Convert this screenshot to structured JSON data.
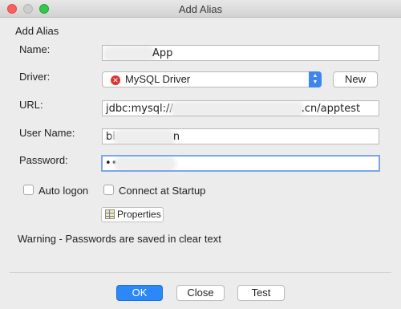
{
  "window": {
    "title": "Add Alias"
  },
  "section_title": "Add Alias",
  "form": {
    "name": {
      "label": "Name:",
      "value_suffix": "App"
    },
    "driver": {
      "label": "Driver:",
      "selected": "MySQL Driver",
      "new_label": "New"
    },
    "url": {
      "label": "URL:",
      "value_prefix": "jdbc:mysql://",
      "value_suffix": ".cn/apptest"
    },
    "user_name": {
      "label": "User Name:",
      "value_prefix": "bi",
      "value_suffix": "n"
    },
    "password": {
      "label": "Password:",
      "value_masked": "••"
    },
    "auto_logon": {
      "label": "Auto logon",
      "checked": false
    },
    "connect_at_startup": {
      "label": "Connect at Startup",
      "checked": false
    },
    "properties_label": "Properties"
  },
  "warning": "Warning - Passwords are saved in clear text",
  "buttons": {
    "ok": "OK",
    "close": "Close",
    "test": "Test"
  }
}
